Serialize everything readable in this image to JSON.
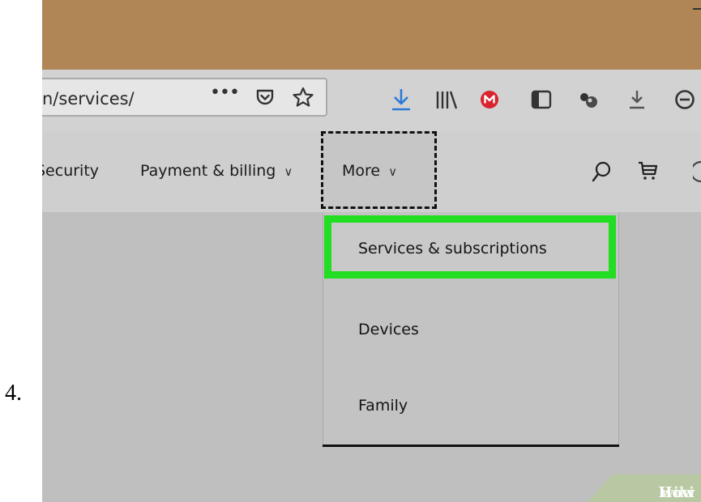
{
  "step": {
    "number": "4."
  },
  "browser": {
    "url": "n/services/",
    "url_more_label": "•••",
    "toolbar_icons": [
      "pocket-icon",
      "bookmark-star-icon",
      "download-arrow-icon",
      "library-icon",
      "mega-icon",
      "sidebar-icon",
      "extension-icon",
      "download-icon",
      "account-icon"
    ]
  },
  "nav": {
    "items": [
      {
        "label": "Security"
      },
      {
        "label": "Payment & billing"
      },
      {
        "label": "More"
      }
    ],
    "chevron": "∨"
  },
  "dropdown": {
    "items": [
      {
        "label": "Services & subscriptions",
        "highlighted": true
      },
      {
        "label": "Devices"
      },
      {
        "label": "Family"
      }
    ]
  },
  "colors": {
    "highlight": "#22dd22",
    "download_accent": "#2a7ad9",
    "mega_red": "#d9232e",
    "titlebar": "#b08656"
  },
  "watermark": {
    "prefix": "wiki",
    "suffix": "How"
  }
}
